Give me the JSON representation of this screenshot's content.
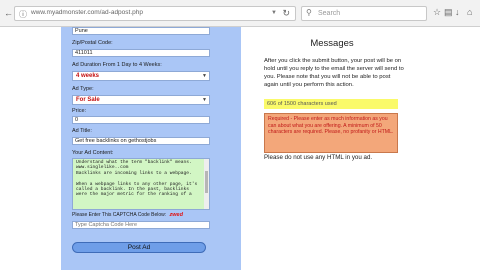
{
  "browser": {
    "url": "www.myadmonster.com/ad-adpost.php",
    "search_placeholder": "Search"
  },
  "form": {
    "partial_value": "Pune",
    "zip_label": "Zip/Postal Code:",
    "zip_value": "411011",
    "duration_label": "Ad Duration From 1 Day to 4 Weeks:",
    "duration_value": "4 weeks",
    "adtype_label": "Ad Type:",
    "adtype_value": "For Sale",
    "price_label": "Price:",
    "price_value": "0",
    "title_label": "Ad Title:",
    "title_value": "Get free backlinks on gethostjobs",
    "content_label": "Your Ad Content:",
    "content_text": "Understand what the term \"backlink\" means.\nwww.singlelike..com\nBacklinks are incoming links to a webpage.\n\nWhen a webpage links to any other page, it's\ncalled a backlink. In the past, backlinks\nwere the major metric for the ranking of a",
    "captcha_label": "Please Enter This CAPTCHA Code Below:",
    "captcha_code": "zwed",
    "captcha_placeholder": "Type Captcha Code Here",
    "post_button": "Post Ad"
  },
  "messages": {
    "title": "Messages",
    "body": "After you click the submit button, your post will be on hold until you reply to the email the server will send to you. Please note that you will not be able to post again until you perform this action.",
    "char_count": "606 of 1500 characters used",
    "required": "Required - Please enter as much information as you can about what you are offering. A minimum of 50 characters are required. Please, no profanity or HTML.",
    "no_html": "Please do not use any HTML in you ad."
  }
}
